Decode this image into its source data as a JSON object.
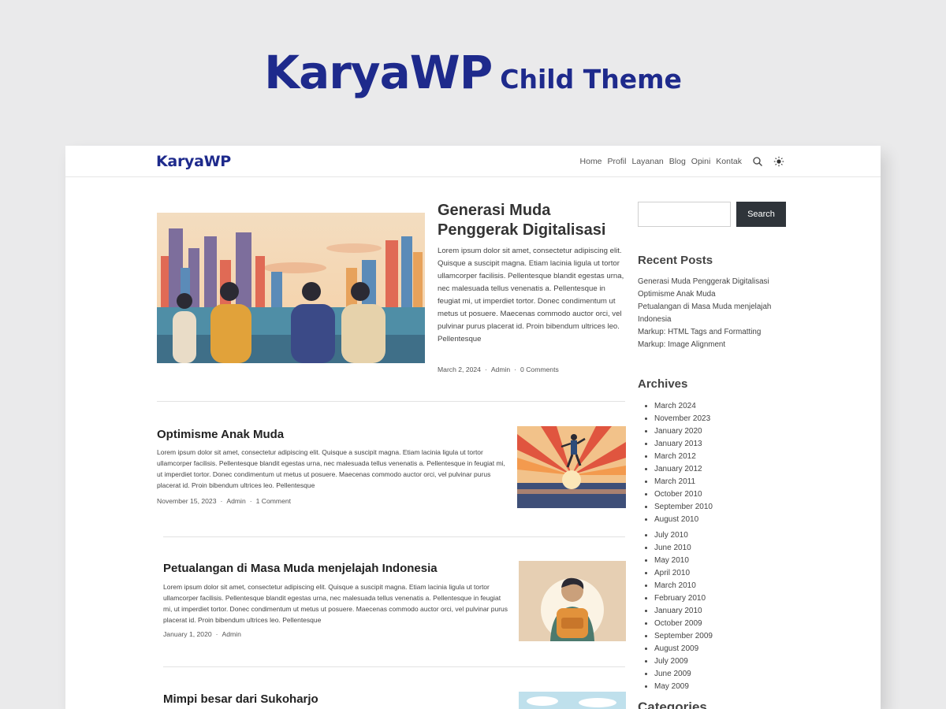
{
  "hero": {
    "brand": "KaryaWP",
    "subtitle": "Child Theme"
  },
  "header": {
    "logo": "KaryaWP",
    "nav": [
      "Home",
      "Profil",
      "Layanan",
      "Blog",
      "Opini",
      "Kontak"
    ]
  },
  "featured": {
    "title": "Generasi Muda Penggerak Digitalisasi",
    "excerpt": "Lorem ipsum dolor sit amet, consectetur adipiscing elit. Quisque a suscipit magna. Etiam lacinia ligula ut tortor ullamcorper facilisis. Pellentesque blandit egestas urna, nec malesuada tellus venenatis a. Pellentesque in feugiat mi, ut imperdiet tortor. Donec condimentum ut metus ut posuere. Maecenas commodo auctor orci, vel pulvinar purus placerat id. Proin bibendum ultrices leo. Pellentesque",
    "date": "March 2, 2024",
    "author": "Admin",
    "comments": "0 Comments"
  },
  "posts": [
    {
      "title": "Optimisme Anak Muda",
      "excerpt": "Lorem ipsum dolor sit amet, consectetur adipiscing elit. Quisque a suscipit magna. Etiam lacinia ligula ut tortor ullamcorper facilisis. Pellentesque blandit egestas urna, nec malesuada tellus venenatis a. Pellentesque in feugiat mi, ut imperdiet tortor. Donec condimentum ut metus ut posuere. Maecenas commodo auctor orci, vel pulvinar purus placerat id. Proin bibendum ultrices leo. Pellentesque",
      "date": "November 15, 2023",
      "author": "Admin",
      "comments": "1 Comment"
    },
    {
      "title": "Petualangan di Masa Muda menjelajah Indonesia",
      "excerpt": "Lorem ipsum dolor sit amet, consectetur adipiscing elit. Quisque a suscipit magna. Etiam lacinia ligula ut tortor ullamcorper facilisis. Pellentesque blandit egestas urna, nec malesuada tellus venenatis a. Pellentesque in feugiat mi, ut imperdiet tortor. Donec condimentum ut metus ut posuere. Maecenas commodo auctor orci, vel pulvinar purus placerat id. Proin bibendum ultrices leo. Pellentesque",
      "date": "January 1, 2020",
      "author": "Admin"
    },
    {
      "title": "Mimpi besar dari Sukoharjo"
    }
  ],
  "sidebar": {
    "search_button": "Search",
    "recent_title": "Recent Posts",
    "recent": [
      "Generasi Muda Penggerak Digitalisasi",
      "Optimisme Anak Muda",
      "Petualangan di Masa Muda menjelajah Indonesia",
      "Markup: HTML Tags and Formatting",
      "Markup: Image Alignment"
    ],
    "archives_title": "Archives",
    "archives": [
      "March 2024",
      "November 2023",
      "January 2020",
      "January 2013",
      "March 2012",
      "January 2012",
      "March 2011",
      "October 2010",
      "September 2010",
      "August 2010",
      "July 2010",
      "June 2010",
      "May 2010",
      "April 2010",
      "March 2010",
      "February 2010",
      "January 2010",
      "October 2009",
      "September 2009",
      "August 2009",
      "July 2009",
      "June 2009",
      "May 2009"
    ],
    "categories_title": "Categories"
  },
  "colors": {
    "brand": "#1e2a8c",
    "button": "#2f343a"
  }
}
